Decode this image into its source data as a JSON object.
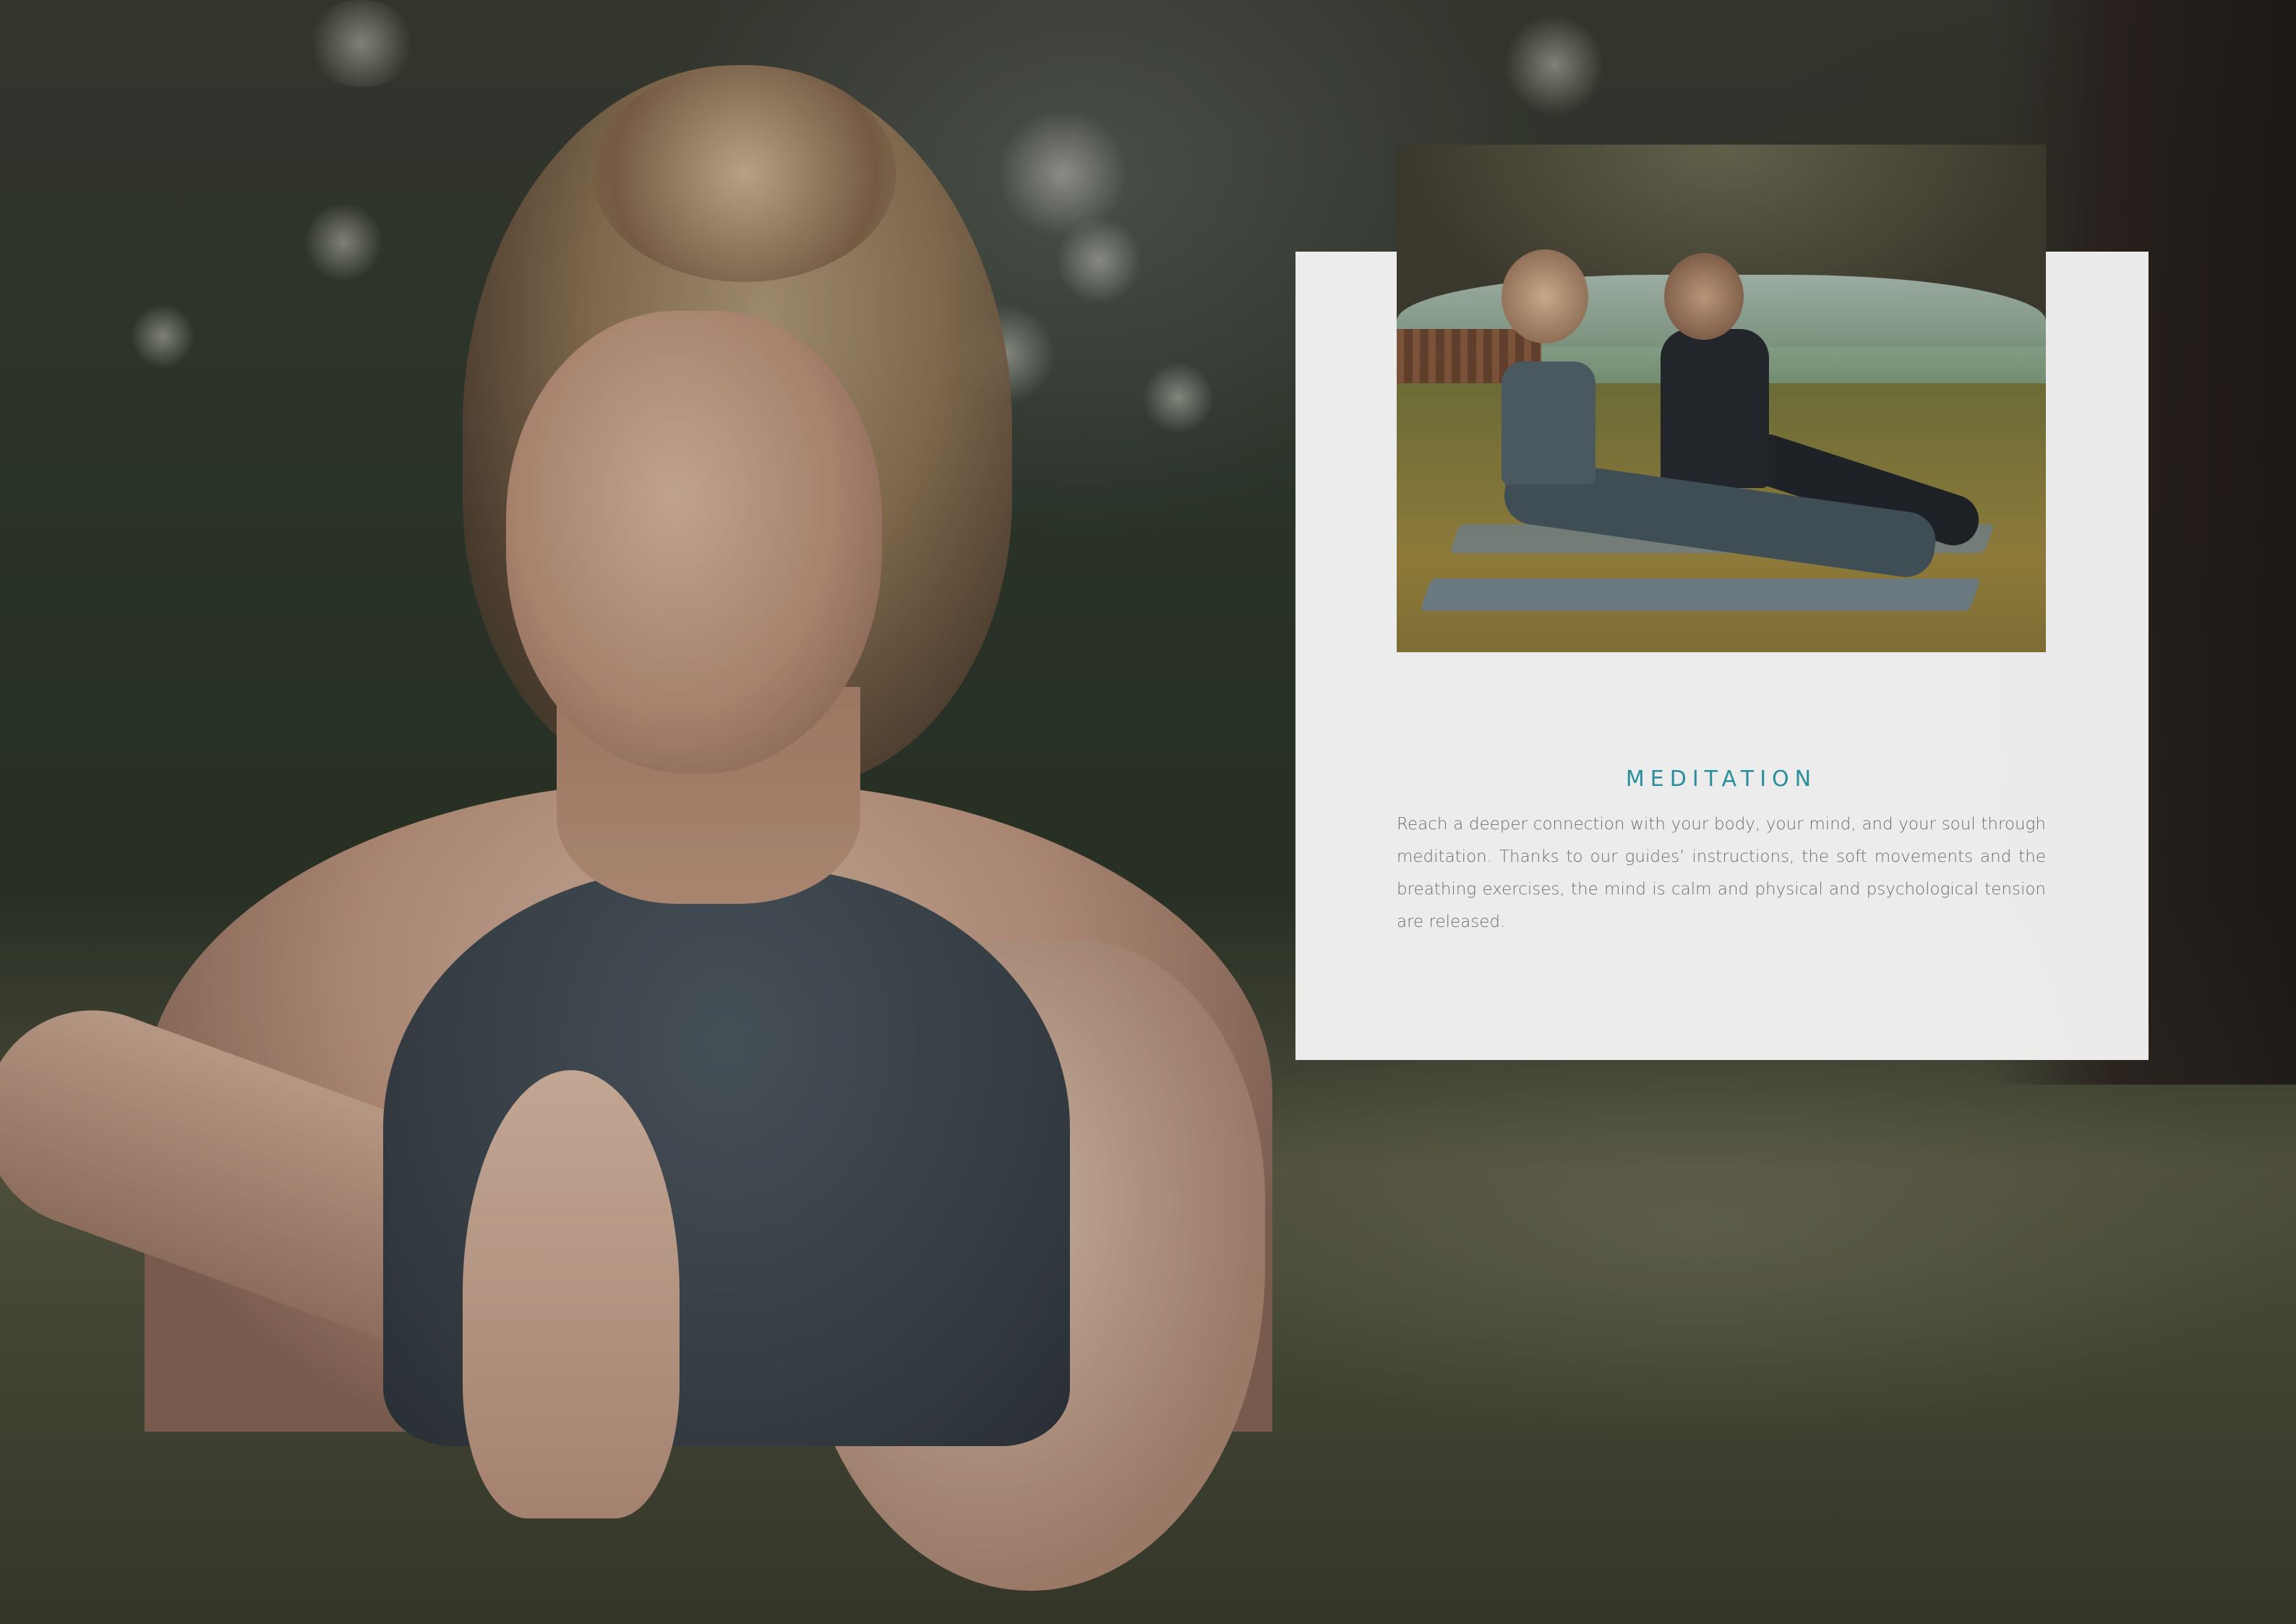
{
  "card": {
    "title": "MEDITATION",
    "body": "Reach a deeper connection with your body, your mind, and your soul through meditation. Thanks to our guides’ instructions, the soft movements and the breathing exercises, the mind is calm and physical and psychological tension are released.",
    "title_color": "#2b8f9b",
    "text_color": "#6e6e6e",
    "background": "#f4f4f4"
  }
}
